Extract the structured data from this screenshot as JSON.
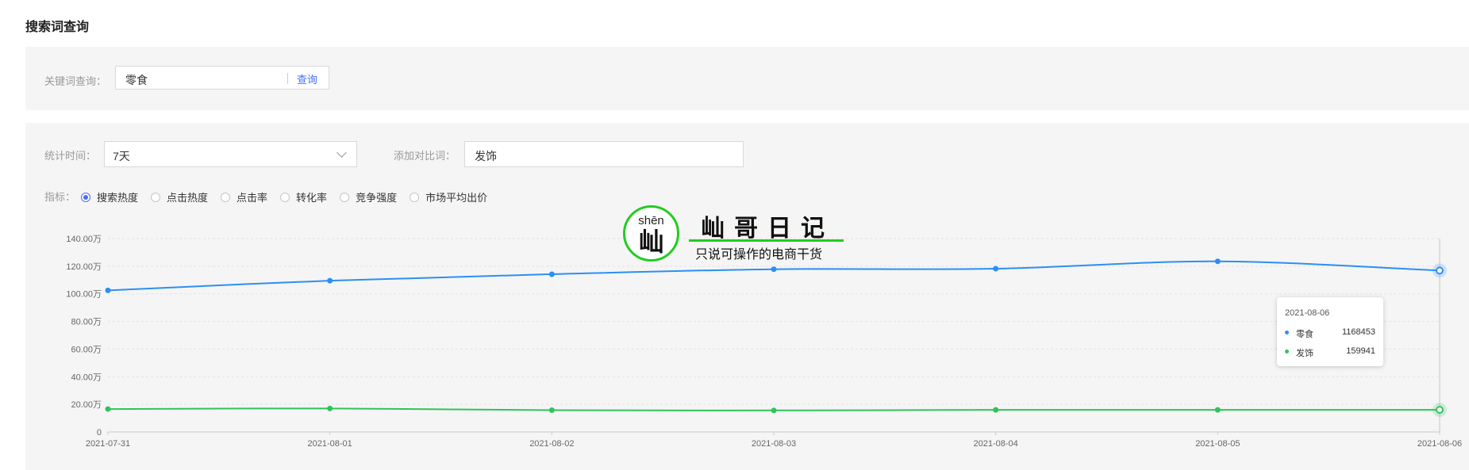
{
  "page_title": "搜索词查询",
  "search": {
    "label": "关键词查询：",
    "value": "零食",
    "button": "查询"
  },
  "filters": {
    "time_label": "统计时间：",
    "time_value": "7天",
    "compare_label": "添加对比词：",
    "compare_value": "发饰",
    "metric_label": "指标：",
    "metrics": [
      {
        "label": "搜索热度",
        "selected": true
      },
      {
        "label": "点击热度",
        "selected": false
      },
      {
        "label": "点击率",
        "selected": false
      },
      {
        "label": "转化率",
        "selected": false
      },
      {
        "label": "竞争强度",
        "selected": false
      },
      {
        "label": "市场平均出价",
        "selected": false
      }
    ]
  },
  "chart_data": {
    "type": "line",
    "x": [
      "2021-07-31",
      "2021-08-01",
      "2021-08-02",
      "2021-08-03",
      "2021-08-04",
      "2021-08-05",
      "2021-08-06"
    ],
    "y_ticks": [
      "0",
      "20.00万",
      "40.00万",
      "60.00万",
      "80.00万",
      "100.00万",
      "120.00万",
      "140.00万"
    ],
    "ylim": [
      0,
      1400000
    ],
    "grid": true,
    "series": [
      {
        "name": "零食",
        "color": "#2b8ff5",
        "values": [
          1025000,
          1095000,
          1142000,
          1178000,
          1182000,
          1235000,
          1168453
        ]
      },
      {
        "name": "发饰",
        "color": "#2ec45a",
        "values": [
          166000,
          170000,
          158000,
          156000,
          160000,
          160000,
          159941
        ]
      }
    ]
  },
  "tooltip": {
    "date": "2021-08-06",
    "rows": [
      {
        "name": "零食",
        "value": "1168453",
        "color": "#2b8ff5"
      },
      {
        "name": "发饰",
        "value": "159941",
        "color": "#2ec45a"
      }
    ]
  },
  "watermark": {
    "pinyin": "shēn",
    "char": "屾",
    "title": "屾哥日记",
    "subtitle": "只说可操作的电商干货"
  }
}
